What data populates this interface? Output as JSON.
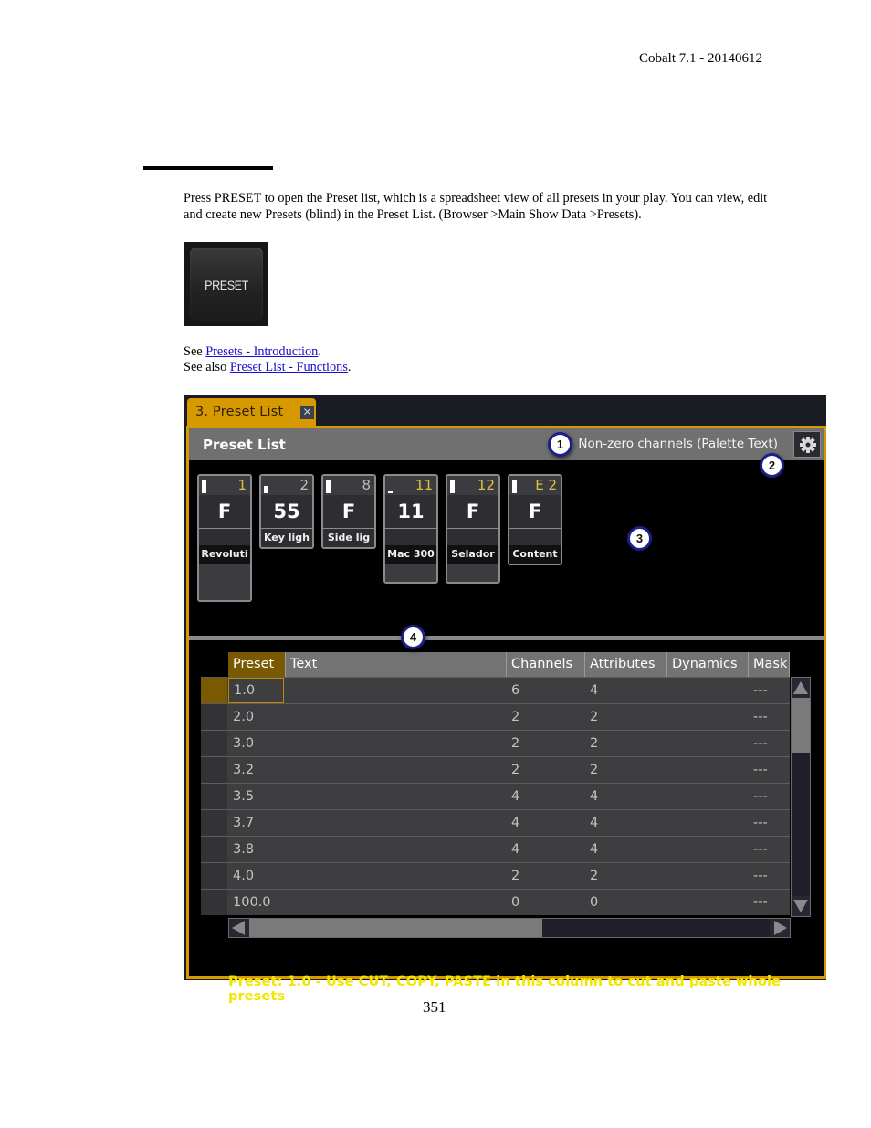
{
  "header": {
    "doc_version": "Cobalt 7.1 - 20140612"
  },
  "intro": {
    "paragraph": "Press PRESET to open the Preset list, which is a spreadsheet view of all presets in your play. You can view, edit and create new Presets (blind) in the Preset List. (Browser >Main Show Data >Presets).",
    "key_label": "PRESET",
    "see_prefix": "See ",
    "see_link": "Presets - Introduction",
    "see_suffix": ".",
    "see_also_prefix": "See also ",
    "see_also_link": "Preset List - Functions",
    "see_also_suffix": "."
  },
  "screenshot": {
    "tab_label": "3. Preset List",
    "tab_close": "✕",
    "title": "Preset List",
    "mode_label": "Non-zero channels (Palette Text)",
    "callouts": [
      "1",
      "2",
      "3",
      "4"
    ],
    "colors": {
      "accent": "#d69a00",
      "status_text": "#f2e600",
      "tile_number_highlight": "#e0c040"
    },
    "tiles": [
      {
        "number": "1",
        "value": "F",
        "name": "Revoluti",
        "level": 1.0,
        "number_color": "#e0c040"
      },
      {
        "number": "2",
        "value": "55",
        "name": "Key ligh",
        "level": 0.55,
        "number_color": "#bdbdbd"
      },
      {
        "number": "8",
        "value": "F",
        "name": "Side lig",
        "level": 1.0,
        "number_color": "#bdbdbd"
      },
      {
        "number": "11",
        "value": "11",
        "name": "Mac 300",
        "level": 0.11,
        "number_color": "#e0c040"
      },
      {
        "number": "12",
        "value": "F",
        "name": "Selador",
        "level": 1.0,
        "number_color": "#e0c040"
      },
      {
        "number": "E 2",
        "value": "F",
        "name": "Content",
        "level": 1.0,
        "number_color": "#e0c040"
      }
    ],
    "table": {
      "columns": [
        "Preset",
        "Text",
        "Channels",
        "Attributes",
        "Dynamics",
        "Mask"
      ],
      "rows": [
        {
          "preset": "1.0",
          "text": "",
          "channels": "6",
          "attributes": "4",
          "dynamics": "",
          "mask": "---",
          "selected": true
        },
        {
          "preset": "2.0",
          "text": "",
          "channels": "2",
          "attributes": "2",
          "dynamics": "",
          "mask": "---"
        },
        {
          "preset": "3.0",
          "text": "",
          "channels": "2",
          "attributes": "2",
          "dynamics": "",
          "mask": "---"
        },
        {
          "preset": "3.2",
          "text": "",
          "channels": "2",
          "attributes": "2",
          "dynamics": "",
          "mask": "---"
        },
        {
          "preset": "3.5",
          "text": "",
          "channels": "4",
          "attributes": "4",
          "dynamics": "",
          "mask": "---"
        },
        {
          "preset": "3.7",
          "text": "",
          "channels": "4",
          "attributes": "4",
          "dynamics": "",
          "mask": "---"
        },
        {
          "preset": "3.8",
          "text": "",
          "channels": "4",
          "attributes": "4",
          "dynamics": "",
          "mask": "---"
        },
        {
          "preset": "4.0",
          "text": "",
          "channels": "2",
          "attributes": "2",
          "dynamics": "",
          "mask": "---"
        },
        {
          "preset": "100.0",
          "text": "",
          "channels": "0",
          "attributes": "0",
          "dynamics": "",
          "mask": "---"
        }
      ]
    },
    "status_line": "Preset: 1.0 - Use CUT, COPY, PASTE in this column to cut and paste whole presets"
  },
  "footer": {
    "page_number": "351"
  }
}
